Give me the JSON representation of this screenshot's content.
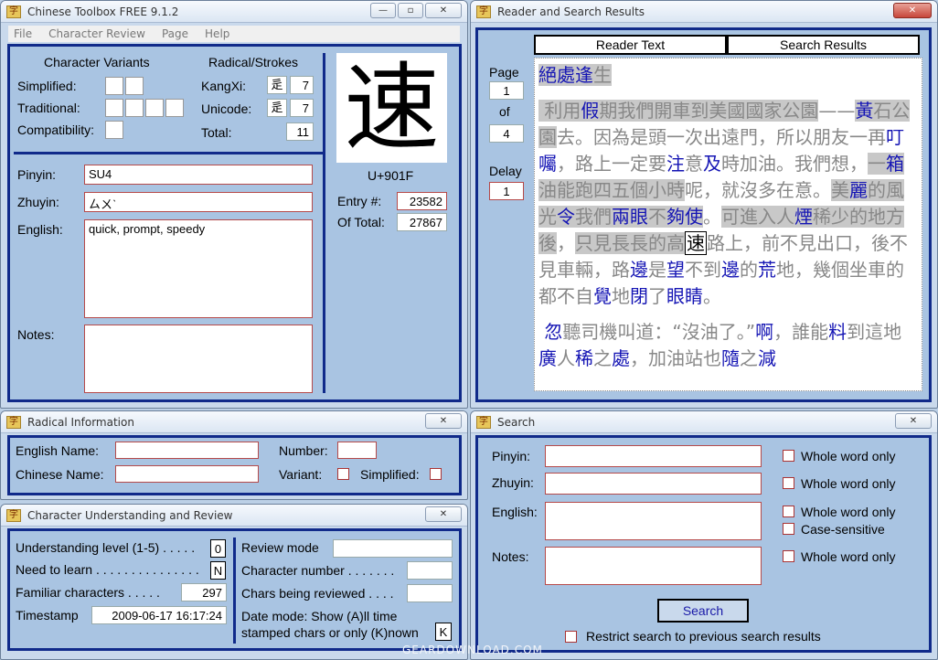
{
  "main_window": {
    "title": "Chinese Toolbox FREE 9.1.2",
    "menu": [
      "File",
      "Character Review",
      "Page",
      "Help"
    ],
    "variants": {
      "header": "Character Variants",
      "simplified_label": "Simplified:",
      "traditional_label": "Traditional:",
      "compatibility_label": "Compatibility:"
    },
    "radical": {
      "header": "Radical/Strokes",
      "kangxi_label": "KangXi:",
      "kangxi_radical": "辵",
      "kangxi_strokes": "7",
      "unicode_label": "Unicode:",
      "unicode_radical": "辵",
      "unicode_strokes": "7",
      "total_label": "Total:",
      "total_value": "11"
    },
    "character": "速",
    "codepoint": "U+901F",
    "entry_label": "Entry #:",
    "entry_value": "23582",
    "of_total_label": "Of Total:",
    "of_total_value": "27867",
    "pinyin_label": "Pinyin:",
    "pinyin_value": "SU4",
    "zhuyin_label": "Zhuyin:",
    "zhuyin_value": "ㄙㄨˋ",
    "english_label": "English:",
    "english_value": "quick, prompt, speedy",
    "notes_label": "Notes:",
    "notes_value": ""
  },
  "reader_window": {
    "title": "Reader and Search Results",
    "tab_reader": "Reader Text",
    "tab_search": "Search Results",
    "page_label": "Page",
    "page_value": "1",
    "of_label": "of",
    "of_value": "4",
    "delay_label": "Delay",
    "delay_value": "1",
    "heading": "絕處逢生",
    "paragraph1": "利用假期我們開車到美國國家公園——黃石公園去。因為是頭一次出遠門，所以朋友一再叮囑，路上一定要注意及時加油。我們想，一箱油能跑四五個小時呢，就沒多在意。美麗的風光令我們兩眼不夠使。可進入人煙稀少的地方後，只見長長的高速路上，前不見出口，後不見車輛，路邊是望不到邊的荒地，幾個坐車的都不自覺地閉了眼睛。",
    "paragraph2": "忽聽司機叫道：“沒油了。”啊，誰能料到這地廣人稀之處，加油站也隨之減"
  },
  "radical_window": {
    "title": "Radical Information",
    "english_name_label": "English Name:",
    "chinese_name_label": "Chinese Name:",
    "number_label": "Number:",
    "variant_label": "Variant:",
    "simplified_label": "Simplified:"
  },
  "review_window": {
    "title": "Character Understanding and Review",
    "understanding_label": "Understanding level (1-5) . . . . .",
    "understanding_value": "0",
    "need_label": "Need to learn . . . . . . . . . . . . . . .",
    "need_value": "N",
    "familiar_label": "Familiar characters . . . . .",
    "familiar_value": "297",
    "timestamp_label": "Timestamp",
    "timestamp_value": "2009-06-17 16:17:24",
    "review_mode_label": "Review mode",
    "char_number_label": "Character number . . . . . . .",
    "chars_reviewed_label": "Chars being reviewed . . . .",
    "date_mode_line1": "Date mode: Show (A)ll time",
    "date_mode_line2": "stamped chars or only (K)nown",
    "date_mode_value": "K"
  },
  "search_window": {
    "title": "Search",
    "pinyin_label": "Pinyin:",
    "zhuyin_label": "Zhuyin:",
    "english_label": "English:",
    "notes_label": "Notes:",
    "whole_word": "Whole word only",
    "case_sensitive": "Case-sensitive",
    "search_button": "Search",
    "restrict_label": "Restrict search to previous search results"
  },
  "watermark": "GEARDOWNLOAD.COM"
}
